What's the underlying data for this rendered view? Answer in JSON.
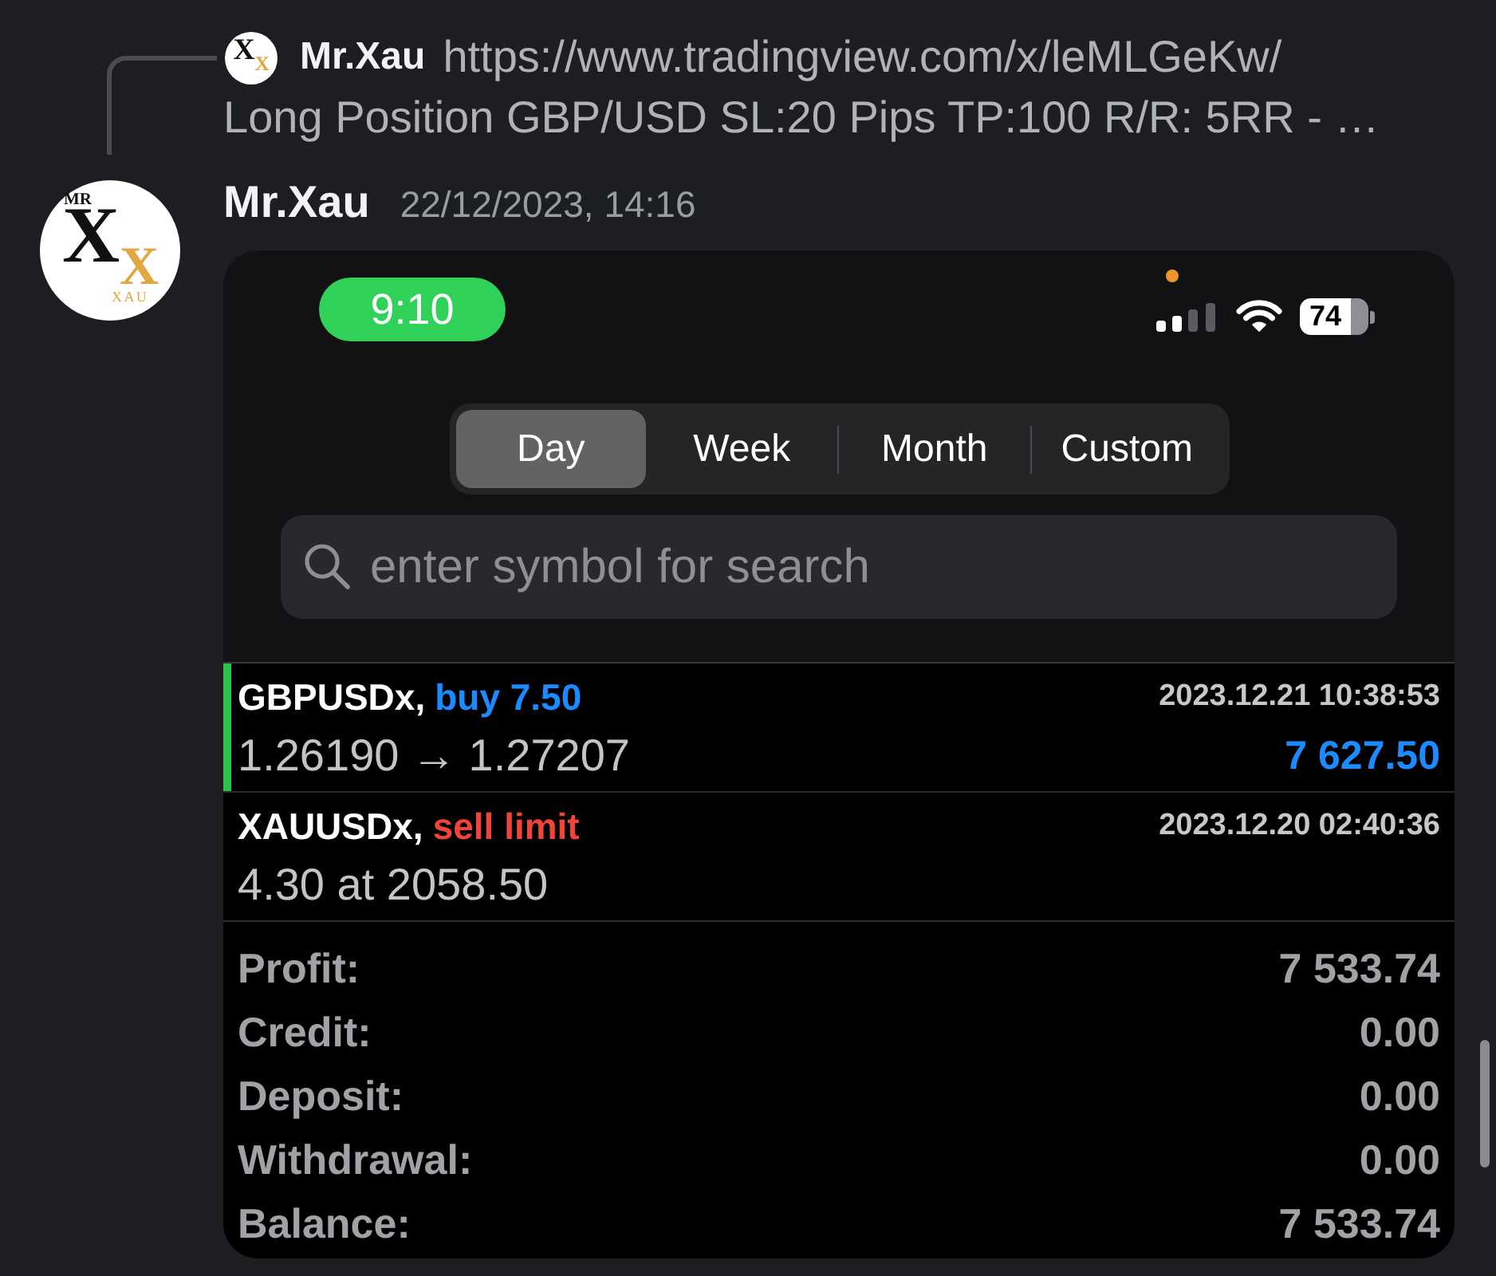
{
  "reply": {
    "avatar": {
      "letters": [
        "X",
        "X"
      ]
    },
    "author": "Mr.Xau",
    "link": "https://www.tradingview.com/x/leMLGeKw/",
    "excerpt": "Long Position GBP/USD SL:20 Pips TP:100 R/R: 5RR - …"
  },
  "message": {
    "avatar": {
      "caption_top": "MR",
      "letters": [
        "X",
        "X"
      ],
      "caption_bottom": "XAU"
    },
    "author": "Mr.Xau",
    "timestamp": "22/12/2023, 14:16",
    "screenshot": {
      "status_bar": {
        "time": "9:10",
        "battery": "74"
      },
      "periods": [
        {
          "label": "Day",
          "selected": true
        },
        {
          "label": "Week",
          "selected": false
        },
        {
          "label": "Month",
          "selected": false
        },
        {
          "label": "Custom",
          "selected": false
        }
      ],
      "search": {
        "placeholder": "enter symbol for search"
      },
      "orders": [
        {
          "kind": "buy",
          "symbol": "GBPUSDx,",
          "action": "buy 7.50",
          "time": "2023.12.21 10:38:53",
          "prices": "1.26190 → 1.27207",
          "profit": "7 627.50",
          "highlighted": true
        },
        {
          "kind": "sell",
          "symbol": "XAUUSDx,",
          "action": "sell limit",
          "time": "2023.12.20 02:40:36",
          "prices": "4.30 at 2058.50",
          "highlighted": false
        }
      ],
      "summary": [
        {
          "label": "Profit:",
          "value": "7 533.74"
        },
        {
          "label": "Credit:",
          "value": "0.00"
        },
        {
          "label": "Deposit:",
          "value": "0.00"
        },
        {
          "label": "Withdrawal:",
          "value": "0.00"
        },
        {
          "label": "Balance:",
          "value": "7 533.74"
        }
      ]
    }
  }
}
